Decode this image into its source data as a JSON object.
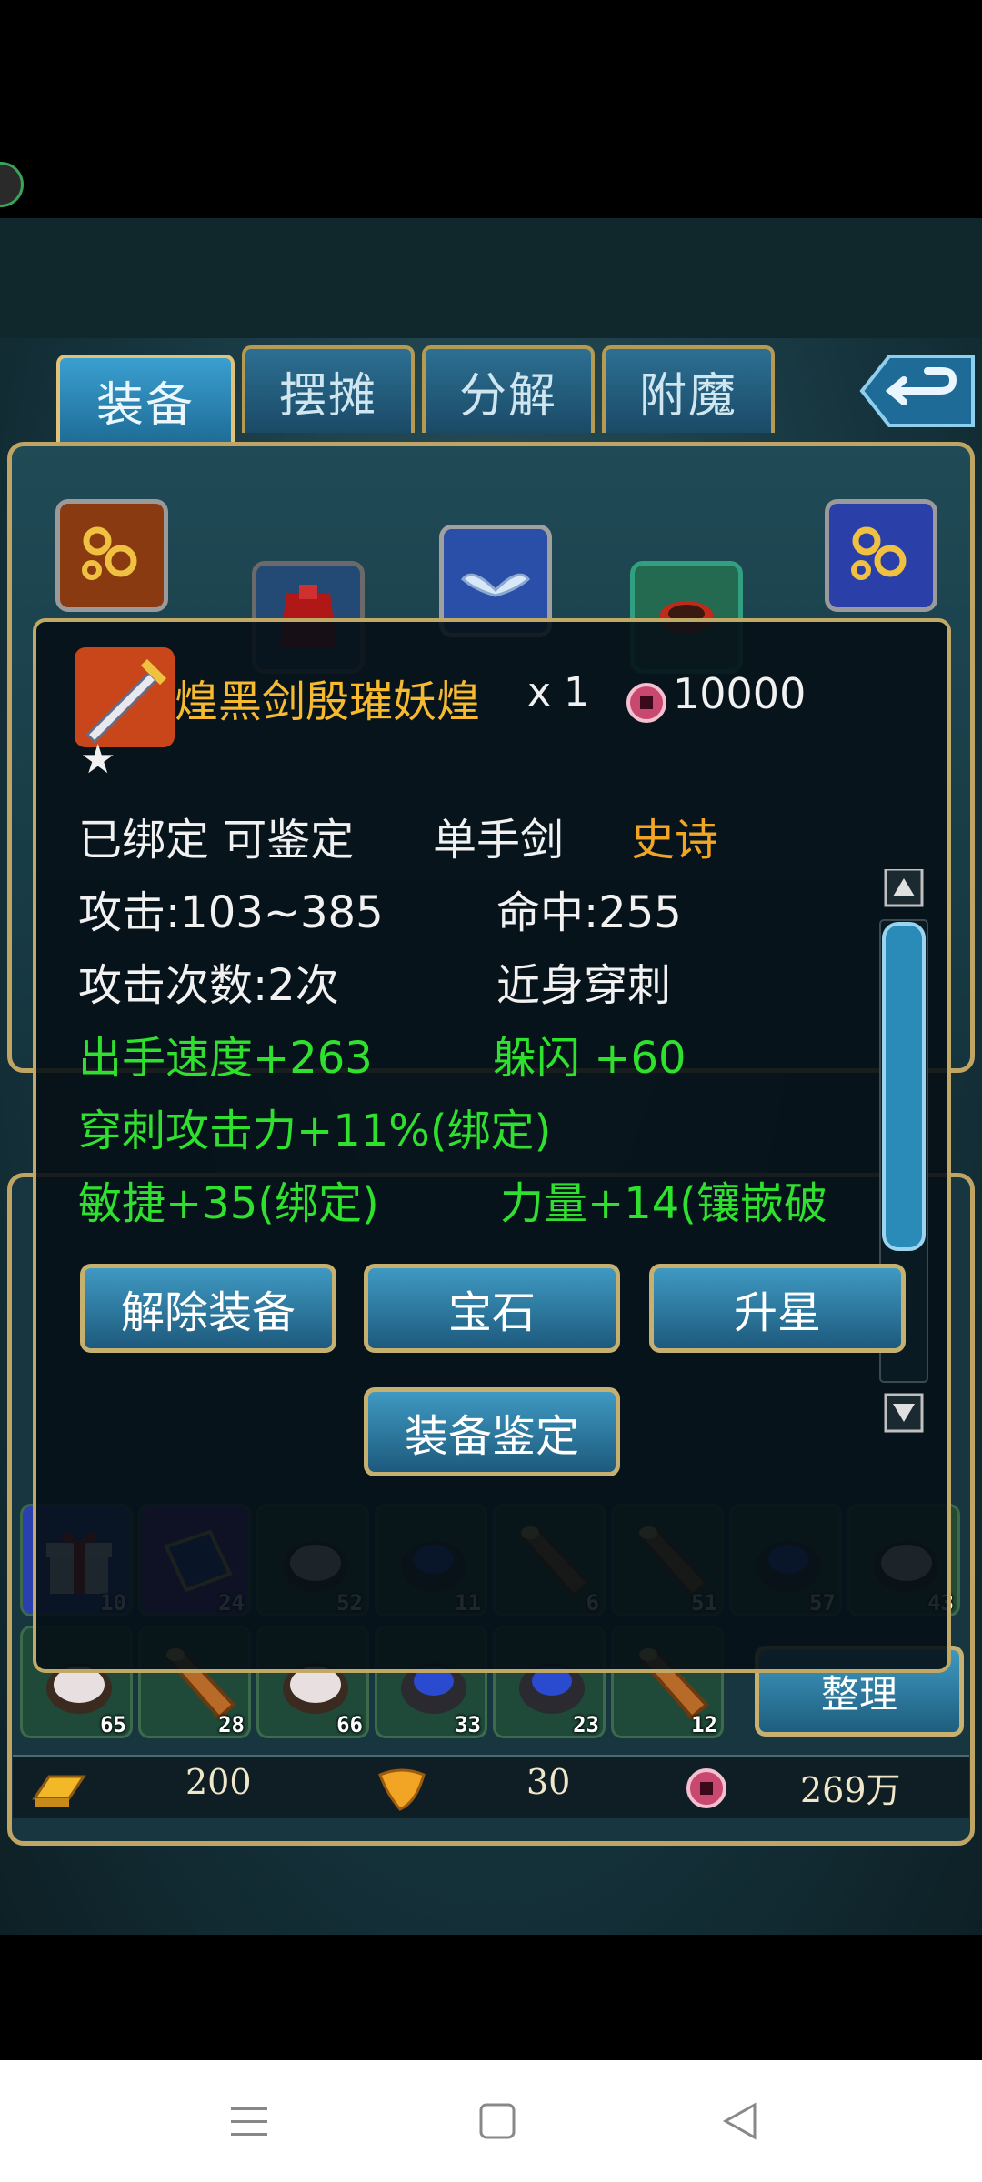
{
  "tabs": [
    {
      "label": "装备"
    },
    {
      "label": "摆摊"
    },
    {
      "label": "分解"
    },
    {
      "label": "附魔"
    }
  ],
  "tooltip": {
    "item_name": "煌黑剑殷璀妖煌",
    "quantity": "x 1",
    "price": "10000",
    "stars": "★",
    "status": "已绑定 可鉴定",
    "weapon_type": "单手剑",
    "rarity": "史诗",
    "attack": "攻击:103~385",
    "hit": "命中:255",
    "attack_times": "攻击次数:2次",
    "melee_pierce": "近身穿刺",
    "speed": "出手速度+263",
    "dodge": "躲闪 +60",
    "pierce_attack": "穿刺攻击力+11%(绑定)",
    "agility": "敏捷+35(绑定)",
    "strength": "力量+14(镶嵌破",
    "buttons": {
      "unequip": "解除装备",
      "gem": "宝石",
      "star_up": "升星",
      "identify": "装备鉴定"
    }
  },
  "inventory": {
    "row1": [
      {
        "item": "gift-box",
        "count": "10"
      },
      {
        "item": "blue-book",
        "count": "24"
      },
      {
        "item": "silver-ore",
        "count": "52"
      },
      {
        "item": "sapphire-ore",
        "count": "11"
      },
      {
        "item": "wood-log",
        "count": "6"
      },
      {
        "item": "wood-log",
        "count": "51"
      },
      {
        "item": "sapphire-ore",
        "count": "57"
      },
      {
        "item": "silver-ore",
        "count": "43"
      }
    ],
    "row2": [
      {
        "item": "silver-ore",
        "count": "65"
      },
      {
        "item": "wood-log",
        "count": "28"
      },
      {
        "item": "silver-ore",
        "count": "66"
      },
      {
        "item": "sapphire-ore",
        "count": "33"
      },
      {
        "item": "sapphire-ore",
        "count": "23"
      },
      {
        "item": "wood-log",
        "count": "12"
      }
    ],
    "sort_label": "整理"
  },
  "currency": {
    "gold": "200",
    "leaf": "30",
    "coin": "269万"
  },
  "colors": {
    "tab_active": "#3a9fd0",
    "frame_gold": "#bfa464",
    "stat_green": "#2fe02f",
    "rarity_orange": "#f2a424"
  }
}
